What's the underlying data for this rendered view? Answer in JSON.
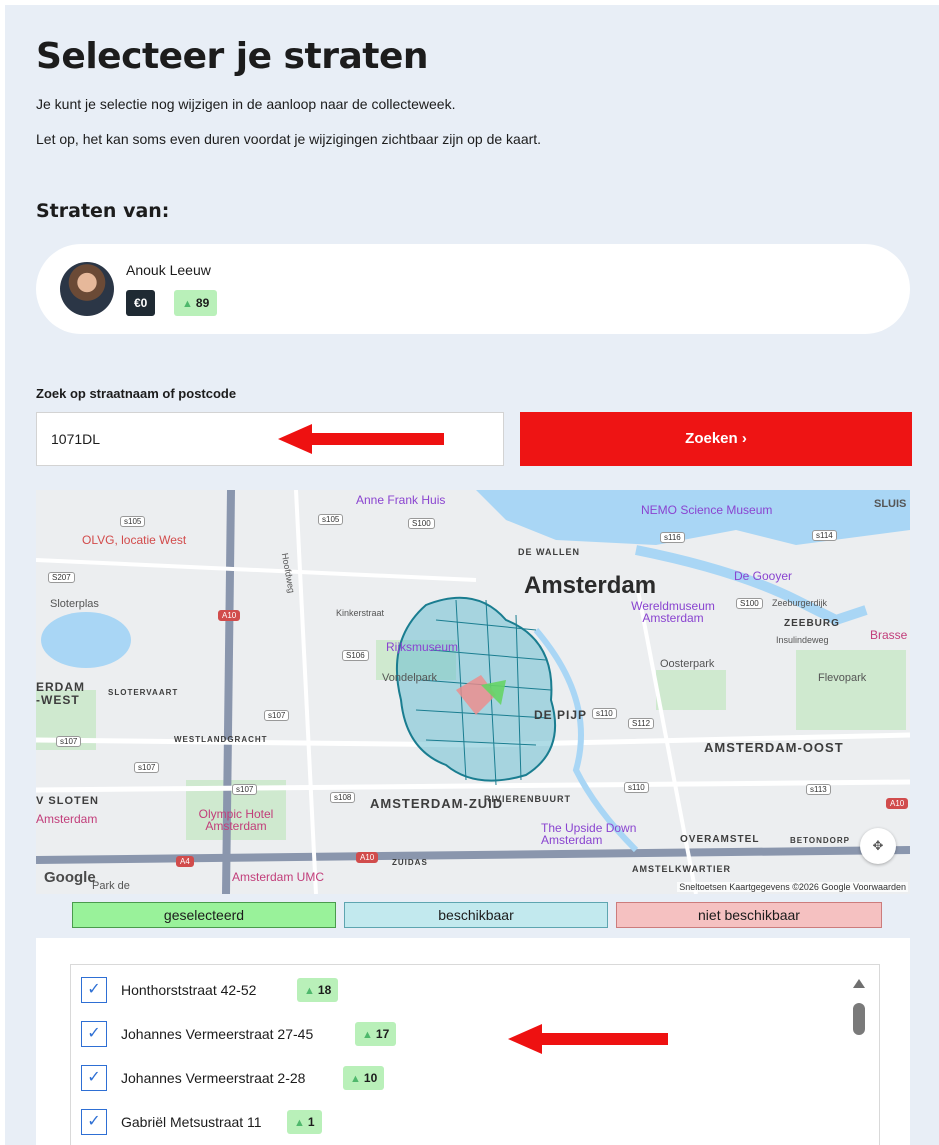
{
  "page": {
    "title": "Selecteer je straten",
    "intro_line1": "Je kunt je selectie nog wijzigen in de aanloop naar de collecteweek.",
    "intro_line2": "Let op, het kan soms even duren voordat je wijzigingen zichtbaar zijn op de kaart.",
    "section_title": "Straten van:"
  },
  "person": {
    "name": "Anouk Leeuw",
    "euro_badge": "€0",
    "homes_badge": "89"
  },
  "search": {
    "label": "Zoek op straatnaam of postcode",
    "value": "1071DL",
    "button_label": "Zoeken ›"
  },
  "map": {
    "city": "Amsterdam",
    "labels": {
      "anne_frank": "Anne Frank Huis",
      "nemo": "NEMO Science Museum",
      "sluis": "SLUIS",
      "olvg": "OLVG, locatie West",
      "de_wallen": "DE WALLEN",
      "de_gooyer": "De Gooyer",
      "sloterplas": "Sloterplas",
      "kinkerstraat": "Kinkerstraat",
      "hoofdweg": "Hoofdweg",
      "wereldmuseum": "Wereldmuseum Amsterdam",
      "zeeburgerdijk": "Zeeburgerdijk",
      "zeeburg": "ZEEBURG",
      "insulindeweg": "Insulindeweg",
      "brasse": "Brasse",
      "oosterpark": "Oosterpark",
      "flevopark": "Flevopark",
      "rijksmuseum": "Rijksmuseum",
      "vondelpark": "Vondelpark",
      "erdam_west": "ERDAM\n-WEST",
      "slotervaart": "SLOTERVAART",
      "de_pijp": "DE PIJP",
      "westlandgracht": "WESTLANDGRACHT",
      "amsterdam_oost": "AMSTERDAM-OOST",
      "v_sloten": "V SLOTEN",
      "amsterdam_zuid": "AMSTERDAM-ZUID",
      "rivierenbuurt": "RIVIERENBUURT",
      "amsterdam_left": "Amsterdam",
      "olympic_hotel": "Olympic Hotel Amsterdam",
      "upside_down": "The Upside Down Amsterdam",
      "overamstel": "OVERAMSTEL",
      "betondorp": "BETONDORP",
      "zuidas": "ZUIDAS",
      "amsterdam_umc": "Amsterdam UMC",
      "amstelkwartier": "AMSTELKWARTIER",
      "park_de": "Park de"
    },
    "roads": {
      "s105a": "s105",
      "s105b": "s105",
      "s100a": "S100",
      "s116": "s116",
      "s114": "s114",
      "s207": "S207",
      "a10a": "A10",
      "s100b": "S100",
      "s106": "S106",
      "s107a": "s107",
      "s110": "s110",
      "s112": "S112",
      "s107b": "s107",
      "s107c": "s107",
      "s107d": "s107",
      "s108": "s108",
      "s110b": "s110",
      "s113": "s113",
      "a10b": "A10",
      "a4": "A4",
      "a10c": "A10"
    },
    "google": "Google",
    "attribution": "Sneltoetsen   Kaartgegevens ©2026 Google   Voorwaarden"
  },
  "legend": {
    "selected": "geselecteerd",
    "available": "beschikbaar",
    "unavailable": "niet beschikbaar",
    "colors": {
      "selected": "#99f29a",
      "available": "#c2e9ee",
      "unavailable": "#f5c1c1"
    }
  },
  "streets": [
    {
      "name": "Honthorststraat 42-52",
      "homes": "18",
      "checked": true
    },
    {
      "name": "Johannes Vermeerstraat 27-45",
      "homes": "17",
      "checked": true
    },
    {
      "name": "Johannes Vermeerstraat 2-28",
      "homes": "10",
      "checked": true
    },
    {
      "name": "Gabriël Metsustraat 11",
      "homes": "1",
      "checked": true
    }
  ],
  "colors": {
    "accent_red": "#ee1414",
    "badge_green": "#b9f0b9",
    "badge_dark": "#1f2a33"
  }
}
